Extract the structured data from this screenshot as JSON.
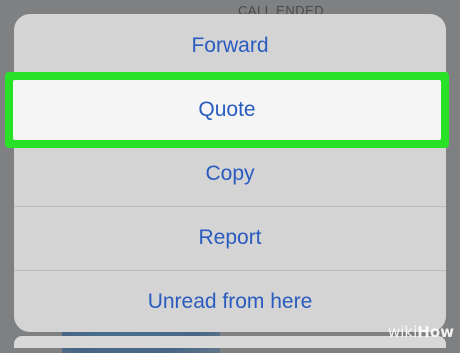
{
  "backdrop": {
    "top_label": "CALL ENDED"
  },
  "action_sheet": {
    "items": [
      {
        "label": "Forward"
      },
      {
        "label": "Quote"
      },
      {
        "label": "Copy"
      },
      {
        "label": "Report"
      },
      {
        "label": "Unread from here"
      }
    ],
    "highlighted_item": "Quote"
  },
  "colors": {
    "action_text": "#2a5bbf",
    "highlight_border": "#29e228",
    "sheet_background": "#d4d4d4",
    "highlight_background": "#f5f5f5"
  },
  "watermark": {
    "part1": "wiki",
    "part2": "How"
  }
}
